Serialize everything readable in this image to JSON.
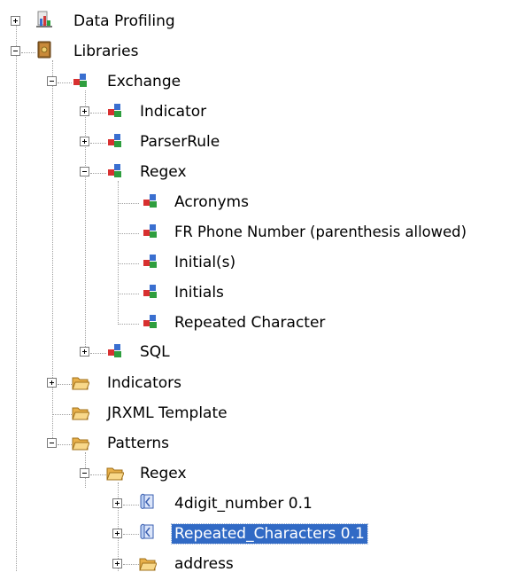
{
  "tree": {
    "data_profiling": "Data Profiling",
    "libraries": "Libraries",
    "exchange": "Exchange",
    "indicator": "Indicator",
    "parser_rule": "ParserRule",
    "regex": "Regex",
    "acronyms": "Acronyms",
    "fr_phone": "FR Phone Number (parenthesis allowed)",
    "initial_s": "Initial(s)",
    "initials": "Initials",
    "repeated_character": "Repeated Character",
    "sql": "SQL",
    "indicators": "Indicators",
    "jrxml_template": "JRXML Template",
    "patterns": "Patterns",
    "patterns_regex": "Regex",
    "fourdigit": "4digit_number 0.1",
    "repeated_characters": "Repeated_Characters 0.1",
    "address": "address"
  },
  "selected_item": "Repeated_Characters 0.1",
  "colors": {
    "selection": "#316ac5",
    "folder": "#f5c66b"
  }
}
